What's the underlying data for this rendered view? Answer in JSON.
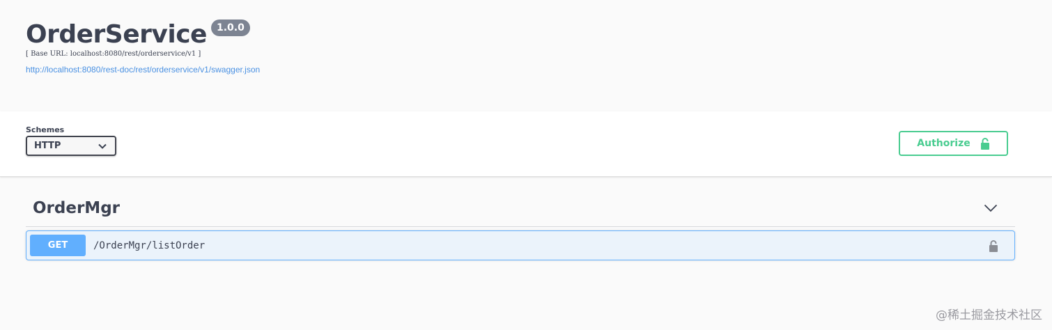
{
  "info": {
    "title": "OrderService",
    "version": "1.0.0",
    "base_url": "[ Base URL: localhost:8080/rest/orderservice/v1 ]",
    "spec_link": "http://localhost:8080/rest-doc/rest/orderservice/v1/swagger.json"
  },
  "schemes": {
    "label": "Schemes",
    "selected": "HTTP"
  },
  "authorize": {
    "label": "Authorize"
  },
  "tags": [
    {
      "name": "OrderMgr",
      "operations": [
        {
          "method": "GET",
          "path": "/OrderMgr/listOrder"
        }
      ]
    }
  ],
  "watermark": "@稀土掘金技术社区",
  "colors": {
    "get": "#61affe",
    "authorize": "#49cc90",
    "link": "#4990e2",
    "version_badge": "#7d8492"
  },
  "icons": {
    "schemes_dropdown": "chevron-down-icon",
    "authorize": "lock-icon",
    "tag_toggle": "chevron-down-icon",
    "operation_lock": "lock-icon"
  }
}
